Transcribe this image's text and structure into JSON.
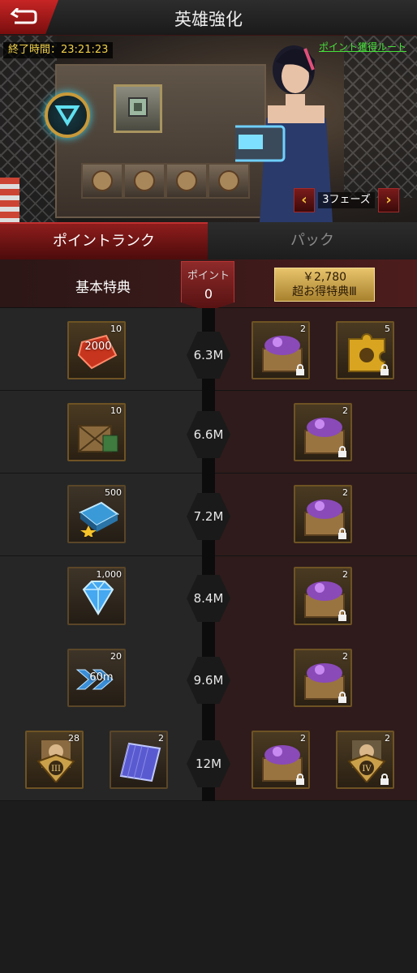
{
  "header": {
    "title": "英雄強化"
  },
  "banner": {
    "end_time_label": "終了時間：23:21:23",
    "point_route_link": "ポイント獲得ルート",
    "phase_label": "3フェーズ"
  },
  "tabs": [
    {
      "label": "ポイントランク",
      "active": true
    },
    {
      "label": "パック",
      "active": false
    }
  ],
  "track_header": {
    "basic_label": "基本特典",
    "point_label": "ポイント",
    "point_value": "0",
    "premium_price": "￥2,780",
    "premium_label": "超お得特典Ⅲ"
  },
  "rows": [
    {
      "threshold": "6.3M",
      "basic": [
        {
          "icon": "red-gem-2000-icon",
          "count": "10",
          "text": "2000"
        }
      ],
      "premium": [
        {
          "icon": "purple-chest-icon",
          "count": "2",
          "locked": true
        },
        {
          "icon": "gold-puzzle-piece-icon",
          "count": "5",
          "locked": true
        }
      ]
    },
    {
      "threshold": "6.6M",
      "basic": [
        {
          "icon": "supply-crate-icon",
          "count": "10"
        }
      ],
      "premium": [
        {
          "icon": "purple-chest-icon",
          "count": "2",
          "locked": true
        }
      ]
    },
    {
      "threshold": "7.2M",
      "basic": [
        {
          "icon": "blue-chip-icon",
          "count": "500"
        }
      ],
      "premium": [
        {
          "icon": "purple-chest-icon",
          "count": "2",
          "locked": true
        }
      ]
    },
    {
      "threshold": "8.4M",
      "basic": [
        {
          "icon": "blue-diamond-icon",
          "count": "1,000"
        }
      ],
      "premium": [
        {
          "icon": "purple-chest-icon",
          "count": "2",
          "locked": true
        }
      ]
    },
    {
      "threshold": "9.6M",
      "basic": [
        {
          "icon": "speedup-60m-icon",
          "count": "20",
          "text": "60m"
        }
      ],
      "premium": [
        {
          "icon": "purple-chest-icon",
          "count": "2",
          "locked": true
        }
      ]
    },
    {
      "threshold": "12M",
      "basic": [
        {
          "icon": "hero-medal-iii-icon",
          "count": "28"
        },
        {
          "icon": "blueprint-card-icon",
          "count": "2"
        }
      ],
      "premium": [
        {
          "icon": "purple-chest-icon",
          "count": "2",
          "locked": true
        },
        {
          "icon": "hero-medal-iv-icon",
          "count": "2",
          "locked": true
        }
      ]
    }
  ],
  "colors": {
    "accent_red": "#8f1d1d",
    "gold": "#e8c46c",
    "link_green": "#46e03a"
  }
}
